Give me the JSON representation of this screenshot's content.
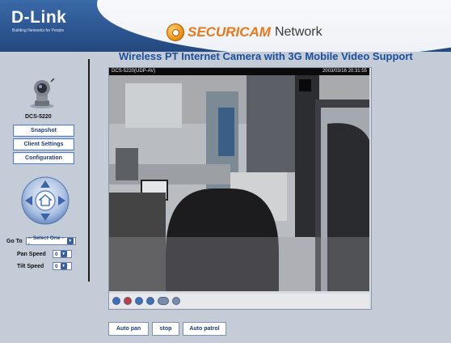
{
  "header": {
    "brand": "D-Link",
    "tagline": "Building Networks for People",
    "product_brand": "SECURICAM",
    "product_suffix": "Network",
    "subtitle": "Wireless PT Internet Camera with 3G Mobile Video Support"
  },
  "sidebar": {
    "model": "DCS-5220",
    "buttons": {
      "snapshot": "Snapshot",
      "client_settings": "Client Settings",
      "configuration": "Configuration"
    },
    "goto_label": "Go To",
    "goto_value": "-- Select One --",
    "pan_label": "Pan Speed",
    "pan_value": "0",
    "tilt_label": "Tilt Speed",
    "tilt_value": "0"
  },
  "video": {
    "caption_left": "DCS-5220(UDP-AV)",
    "caption_right": "2003/03/16 20:31:55",
    "controls": [
      "zoom",
      "record",
      "pause",
      "stop",
      "audio",
      "mic"
    ]
  },
  "bottom": {
    "auto_pan": "Auto pan",
    "stop": "stop",
    "auto_patrol": "Auto patrol"
  }
}
